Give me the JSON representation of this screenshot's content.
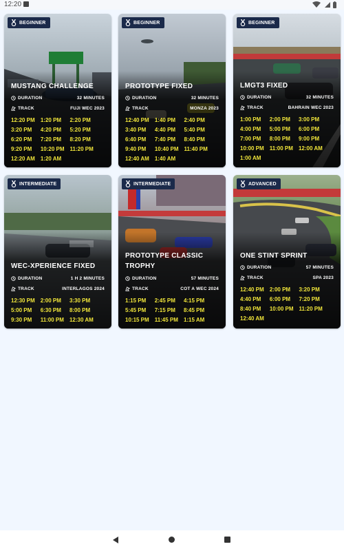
{
  "status_bar": {
    "time": "12:20"
  },
  "cards": [
    {
      "level": "BEGINNER",
      "title_lines": [
        "MUSTANG CHALLENGE"
      ],
      "duration_label": "DURATION",
      "duration": "32 MINUTES",
      "track_label": "TRACK",
      "track": "FUJI WEC 2023",
      "times": [
        "12:20 PM",
        "1:20 PM",
        "2:20 PM",
        "3:20 PM",
        "4:20 PM",
        "5:20 PM",
        "6:20 PM",
        "7:20 PM",
        "8:20 PM",
        "9:20 PM",
        "10:20 PM",
        "11:20 PM",
        "12:20 AM",
        "1:20 AM"
      ]
    },
    {
      "level": "BEGINNER",
      "title_lines": [
        "PROTOTYPE FIXED"
      ],
      "duration_label": "DURATION",
      "duration": "32 MINUTES",
      "track_label": "TRACK",
      "track": "MONZA 2023",
      "times": [
        "12:40 PM",
        "1:40 PM",
        "2:40 PM",
        "3:40 PM",
        "4:40 PM",
        "5:40 PM",
        "6:40 PM",
        "7:40 PM",
        "8:40 PM",
        "9:40 PM",
        "10:40 PM",
        "11:40 PM",
        "12:40 AM",
        "1:40 AM"
      ]
    },
    {
      "level": "BEGINNER",
      "title_lines": [
        "LMGT3 FIXED"
      ],
      "duration_label": "DURATION",
      "duration": "32 MINUTES",
      "track_label": "TRACK",
      "track": "BAHRAIN WEC 2023",
      "times": [
        "1:00 PM",
        "2:00 PM",
        "3:00 PM",
        "4:00 PM",
        "5:00 PM",
        "6:00 PM",
        "7:00 PM",
        "8:00 PM",
        "9:00 PM",
        "10:00 PM",
        "11:00 PM",
        "12:00 AM",
        "1:00 AM"
      ]
    },
    {
      "level": "INTERMEDIATE",
      "title_lines": [
        "WEC-XPERIENCE FIXED"
      ],
      "duration_label": "DURATION",
      "duration": "1 H 2 MINUTES",
      "track_label": "TRACK",
      "track": "INTERLAGOS 2024",
      "times": [
        "12:30 PM",
        "2:00 PM",
        "3:30 PM",
        "5:00 PM",
        "6:30 PM",
        "8:00 PM",
        "9:30 PM",
        "11:00 PM",
        "12:30 AM"
      ]
    },
    {
      "level": "INTERMEDIATE",
      "title_lines": [
        "PROTOTYPE CLASSIC",
        "TROPHY"
      ],
      "duration_label": "DURATION",
      "duration": "57 MINUTES",
      "track_label": "TRACK",
      "track": "COT A WEC 2024",
      "times": [
        "1:15 PM",
        "2:45 PM",
        "4:15 PM",
        "5:45 PM",
        "7:15 PM",
        "8:45 PM",
        "10:15 PM",
        "11:45 PM",
        "1:15 AM"
      ]
    },
    {
      "level": "ADVANCED",
      "title_lines": [
        "ONE STINT SPRINT"
      ],
      "duration_label": "DURATION",
      "duration": "57 MINUTES",
      "track_label": "TRACK",
      "track": "SPA 2023",
      "times": [
        "12:40 PM",
        "2:00 PM",
        "3:20 PM",
        "4:40 PM",
        "6:00 PM",
        "7:20 PM",
        "8:40 PM",
        "10:00 PM",
        "11:20 PM",
        "12:40 AM"
      ]
    }
  ],
  "colors": {
    "badge_bg": "#1b2a4a",
    "time_text": "#f0e53a",
    "page_bg": "#f1f7ff"
  }
}
